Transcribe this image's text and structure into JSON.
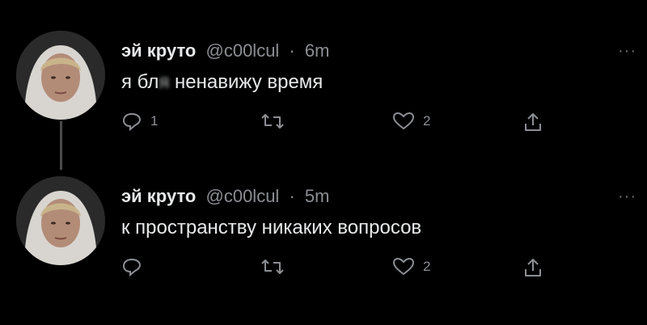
{
  "tweets": [
    {
      "display_name": "эй круто",
      "handle": "@c00lcul",
      "separator": "·",
      "time": "6m",
      "text_before": "я бл",
      "text_blurred": "я",
      "text_after": " ненавижу время",
      "reply_count": "1",
      "retweet_count": "",
      "like_count": "2"
    },
    {
      "display_name": "эй круто",
      "handle": "@c00lcul",
      "separator": "·",
      "time": "5m",
      "text": "к пространству никаких вопросов",
      "reply_count": "",
      "retweet_count": "",
      "like_count": "2"
    }
  ],
  "icons": {
    "reply": "reply-icon",
    "retweet": "retweet-icon",
    "like": "heart-icon",
    "share": "share-icon",
    "more": "more-icon"
  },
  "more_glyph": "···",
  "colors": {
    "background": "#000000",
    "primary_text": "#e7e9ea",
    "secondary_text": "#8b8f94",
    "thread_line": "#4a4a4a"
  }
}
